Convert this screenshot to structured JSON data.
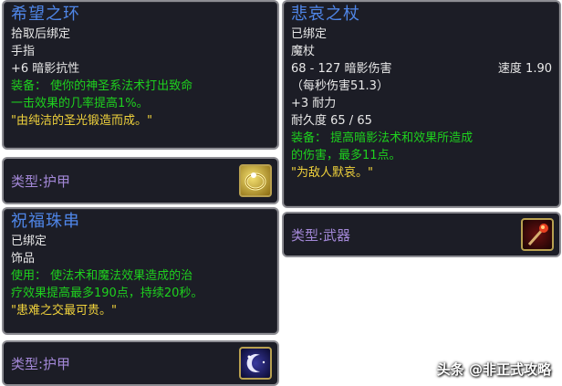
{
  "tooltips": [
    {
      "name": "希望之环",
      "lines": [
        "拾取后绑定",
        "手指",
        "+6 暗影抗性"
      ],
      "equip_lines": [
        "装备： 使你的神圣系法术打出致命",
        "一击效果的几率提高1%。"
      ],
      "flavor": "\"由纯洁的圣光锻造而成。\"",
      "type_label": "类型:护甲",
      "icon": "gold-ring-icon"
    },
    {
      "name": "悲哀之杖",
      "lines": [
        "已绑定",
        "魔杖"
      ],
      "damage": "68 - 127 暗影伤害",
      "speed": "速度 1.90",
      "dps": "（每秒伤害51.3）",
      "stat": "+3 耐力",
      "durability": "耐久度 65 / 65",
      "equip_lines": [
        "装备： 提高暗影法术和效果所造成",
        "的伤害，最多11点。"
      ],
      "flavor": "\"为敌人默哀。\"",
      "type_label": "类型:武器",
      "icon": "red-wand-icon"
    },
    {
      "name": "祝福珠串",
      "lines": [
        "已绑定",
        "饰品"
      ],
      "use_lines": [
        "使用： 使法术和魔法效果造成的治",
        "疗效果提高最多190点，持续20秒。"
      ],
      "flavor": "\"患难之交最可贵。\"",
      "type_label": "类型:护甲",
      "icon": "moon-beads-icon"
    }
  ],
  "watermark": "头条 @非正式攻略",
  "colors": {
    "title": "#4f86e8",
    "green": "#1ed11e",
    "flavor": "#f0d23c",
    "type": "#a287d6"
  }
}
